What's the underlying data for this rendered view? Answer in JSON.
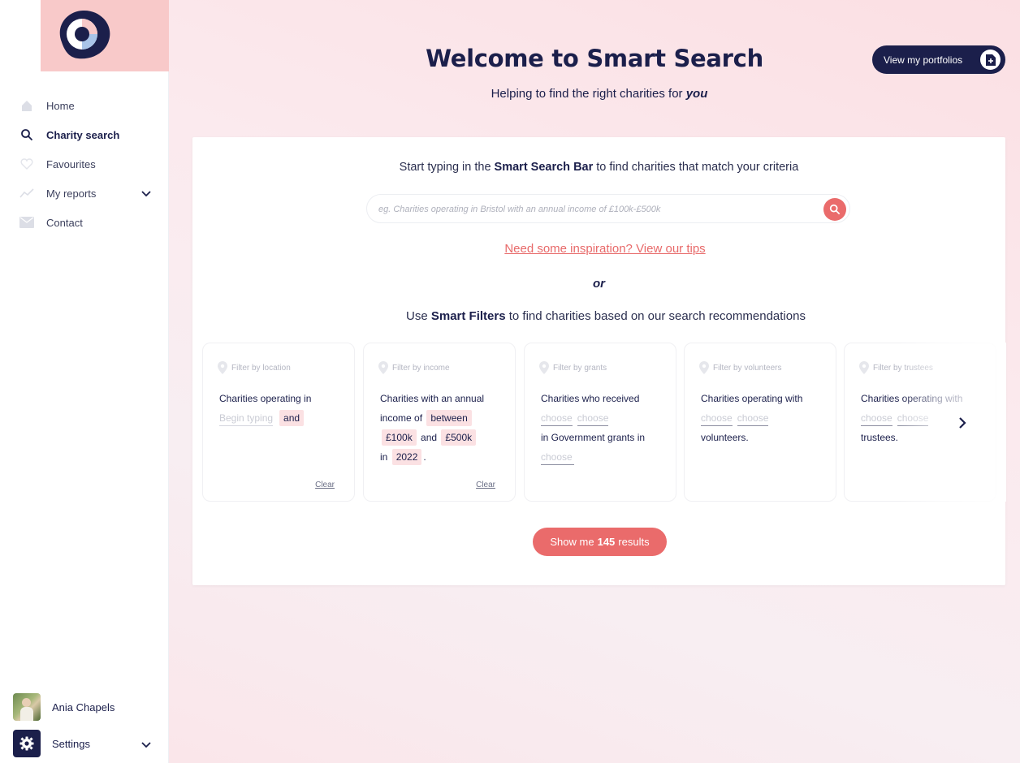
{
  "sidebar": {
    "items": [
      {
        "label": "Home",
        "icon": "home-icon"
      },
      {
        "label": "Charity search",
        "icon": "search-icon",
        "active": true
      },
      {
        "label": "Favourites",
        "icon": "heart-icon"
      },
      {
        "label": "My reports",
        "icon": "trend-icon"
      },
      {
        "label": "Contact",
        "icon": "mail-icon"
      }
    ],
    "user_name": "Ania Chapels",
    "settings_label": "Settings"
  },
  "header": {
    "title": "Welcome to Smart Search",
    "subtitle_prefix": "Helping to find the right charities for ",
    "subtitle_emph": "you",
    "portfolio_button": "View my portfolios"
  },
  "search": {
    "intro_prefix": "Start typing in the ",
    "intro_bold": "Smart Search Bar",
    "intro_suffix": " to find charities that match your criteria",
    "placeholder": "eg. Charities operating in Bristol with an annual income of £100k-£500k",
    "tips_link": "Need some inspiration? View our tips",
    "or_label": "or",
    "filters_prefix": "Use ",
    "filters_bold": "Smart Filters",
    "filters_suffix": " to find charities based on our search recommendations"
  },
  "filters": {
    "location": {
      "head": "Filter by location",
      "text": "Charities operating in",
      "blank": "Begin typing",
      "chip": "and",
      "clear": "Clear"
    },
    "income": {
      "head": "Filter by income",
      "text1": "Charities with an annual",
      "text2": "income of",
      "chip1": "between",
      "chip2": "£100k",
      "and": "and",
      "chip3": "£500k",
      "in": "in",
      "chip4": "2022",
      "dot": ".",
      "clear": "Clear"
    },
    "grants": {
      "head": "Filter by grants",
      "text1": "Charities who received",
      "blank1": "choose",
      "blank2": "choose",
      "text2": "in Government grants in",
      "blank3": "choose"
    },
    "volunteers": {
      "head": "Filter by volunteers",
      "text1": "Charities operating with",
      "blank1": "choose",
      "blank2": "choose",
      "text2": "volunteers."
    },
    "trustees": {
      "head": "Filter by trustees",
      "text1": "Charities operating with",
      "blank1": "choose",
      "blank2": "choose",
      "text2": "trustees."
    }
  },
  "results": {
    "prefix": "Show me",
    "count": "145",
    "suffix": "results"
  },
  "colors": {
    "navy": "#1b1f4b",
    "coral": "#ea6b6b",
    "chip": "#fbe1e3",
    "logo_pink": "#f8c9c9"
  }
}
